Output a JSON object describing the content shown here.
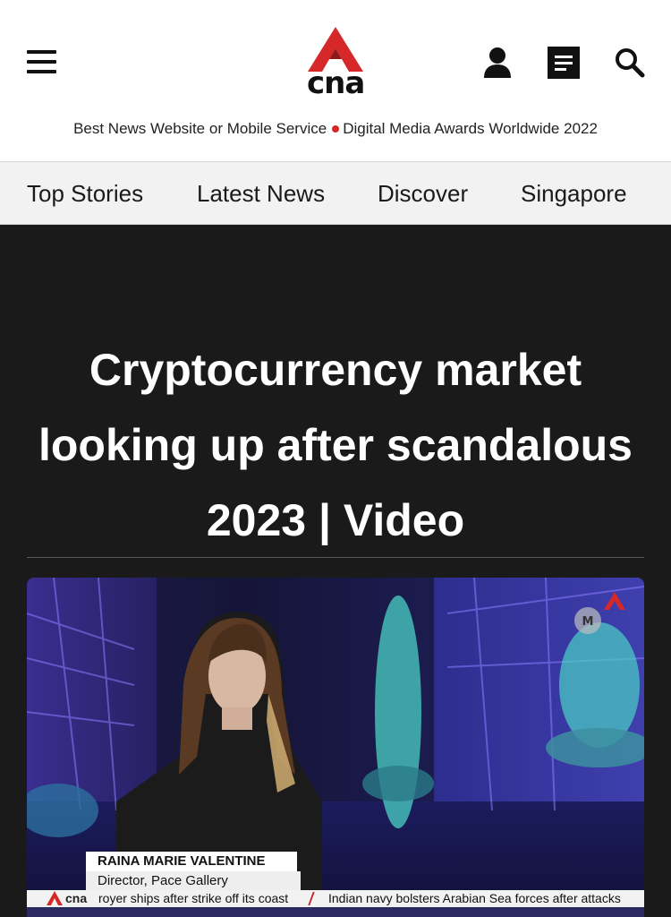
{
  "header": {
    "logo_text": "cna",
    "award_left": "Best News Website or Mobile Service",
    "award_right": "Digital Media Awards Worldwide 2022"
  },
  "nav": {
    "items": [
      "Top Stories",
      "Latest News",
      "Discover",
      "Singapore"
    ]
  },
  "article": {
    "title": "Cryptocurrency market looking up after scandalous 2023 | Video"
  },
  "video": {
    "lower_third_name": "RAINA MARIE VALENTINE",
    "lower_third_role": "Director, Pace Gallery",
    "ticker_logo": "cna",
    "ticker_1": "royer ships after strike off its coast",
    "ticker_2": "Indian navy bolsters Arabian Sea forces after attacks"
  },
  "colors": {
    "brand_red": "#d62828",
    "page_dark": "#1a1a1a"
  }
}
